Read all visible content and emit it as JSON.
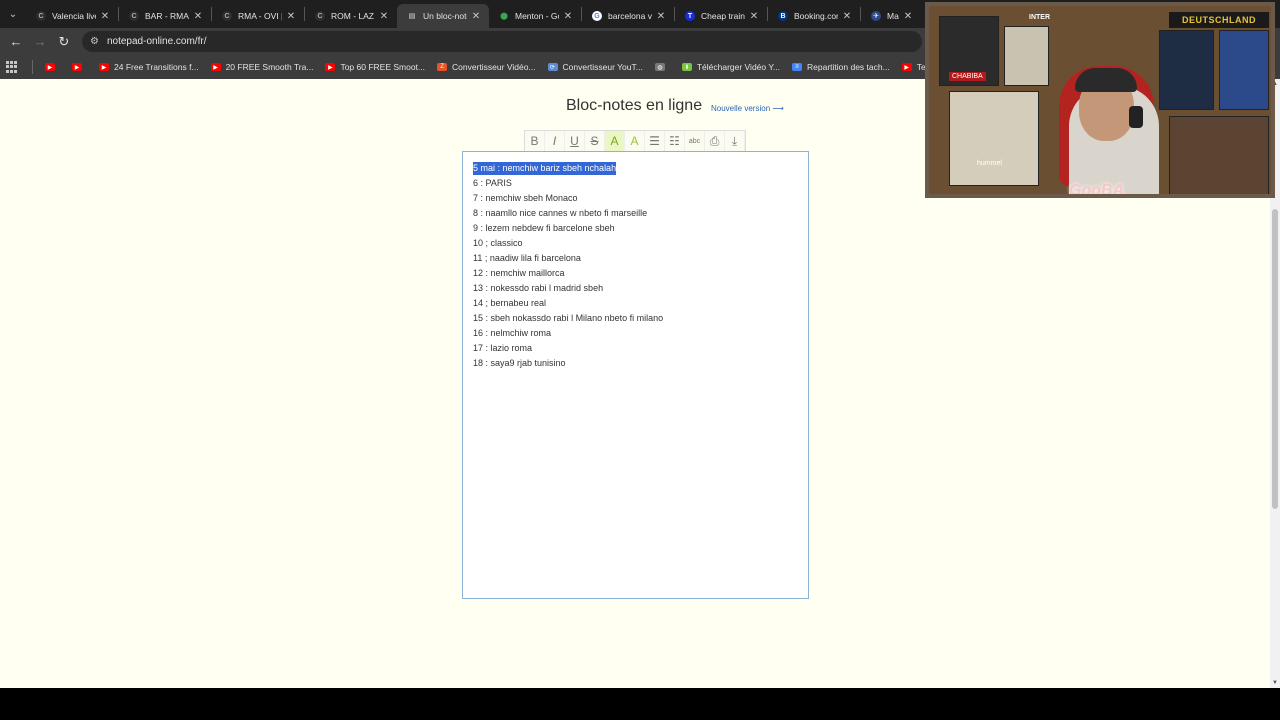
{
  "browser": {
    "tabs": [
      {
        "label": "Valencia live",
        "icon": "globe-c-icon",
        "active": false
      },
      {
        "label": "BAR - RMA |",
        "icon": "globe-c-icon",
        "active": false
      },
      {
        "label": "RMA - OVI |",
        "icon": "globe-c-icon",
        "active": false
      },
      {
        "label": "ROM - LAZ |",
        "icon": "globe-c-icon",
        "active": false
      },
      {
        "label": "Un bloc-note",
        "icon": "document-icon",
        "active": true
      },
      {
        "label": "Menton - Go",
        "icon": "map-pin-icon",
        "active": false
      },
      {
        "label": "barcelona va",
        "icon": "google-icon",
        "active": false
      },
      {
        "label": "Cheap train",
        "icon": "trainline-icon",
        "active": false
      },
      {
        "label": "Booking.com",
        "icon": "booking-icon",
        "active": false
      },
      {
        "label": "Marseille >",
        "icon": "travel-icon",
        "active": false
      }
    ],
    "url": "notepad-online.com/fr/",
    "bookmarks": [
      {
        "label": "",
        "icon": "youtube-icon"
      },
      {
        "label": "",
        "icon": "youtube-icon"
      },
      {
        "label": "24 Free Transitions f...",
        "icon": "youtube-icon"
      },
      {
        "label": "20 FREE Smooth Tra...",
        "icon": "youtube-icon"
      },
      {
        "label": "Top 60 FREE Smoot...",
        "icon": "youtube-icon"
      },
      {
        "label": "Convertisseur Vidéo...",
        "icon": "z-icon"
      },
      {
        "label": "Convertisseur YouT...",
        "icon": "converter-icon"
      },
      {
        "label": "",
        "icon": "globe-icon"
      },
      {
        "label": "Télécharger Vidéo Y...",
        "icon": "download-icon"
      },
      {
        "label": "Repartition des tach...",
        "icon": "docs-icon"
      },
      {
        "label": "Text and Image ani...",
        "icon": "youtube-icon"
      }
    ]
  },
  "page": {
    "title": "Bloc-notes en ligne",
    "new_version_link": "Nouvelle version ⟶",
    "format_buttons": [
      {
        "label": "B",
        "name": "bold-button"
      },
      {
        "label": "I",
        "name": "italic-button"
      },
      {
        "label": "U",
        "name": "underline-button"
      },
      {
        "label": "S",
        "name": "strikethrough-button"
      },
      {
        "label": "A",
        "name": "highlight-button"
      },
      {
        "label": "A",
        "name": "text-color-button"
      },
      {
        "label": "☰",
        "name": "bulleted-list-button"
      },
      {
        "label": "☷",
        "name": "numbered-list-button"
      },
      {
        "label": "abc",
        "name": "spellcheck-button"
      },
      {
        "label": "⎙",
        "name": "print-button"
      },
      {
        "label": "⤓",
        "name": "download-button"
      }
    ],
    "notepad_lines": [
      "5 mai : nemchiw bariz sbeh nchalah",
      "6 : PARIS",
      "7 : nemchiw sbeh Monaco",
      "8 : naamllo nice cannes w nbeto fi marseille",
      "9 : lezem nebdew fi barcelone sbeh",
      "10 ; classico",
      "11 ; naadiw lila fi barcelona",
      "12 : nemchiw maillorca",
      "13 : nokessdo rabi l madrid sbeh",
      "14 ; bernabeu real",
      "15 : sbeh nokassdo rabi l Milano nbeto fi milano",
      "16 : nelmchiw roma",
      "17 : lazio roma",
      "18 : saya9 rjab tunisino"
    ],
    "selected_line_index": 0
  },
  "webcam": {
    "banner": "DEUTSCHLAND",
    "wall_text": "INTER",
    "poster_label": "CHABIBA",
    "shirt_brand": "hummel",
    "signature": "GooBA"
  }
}
